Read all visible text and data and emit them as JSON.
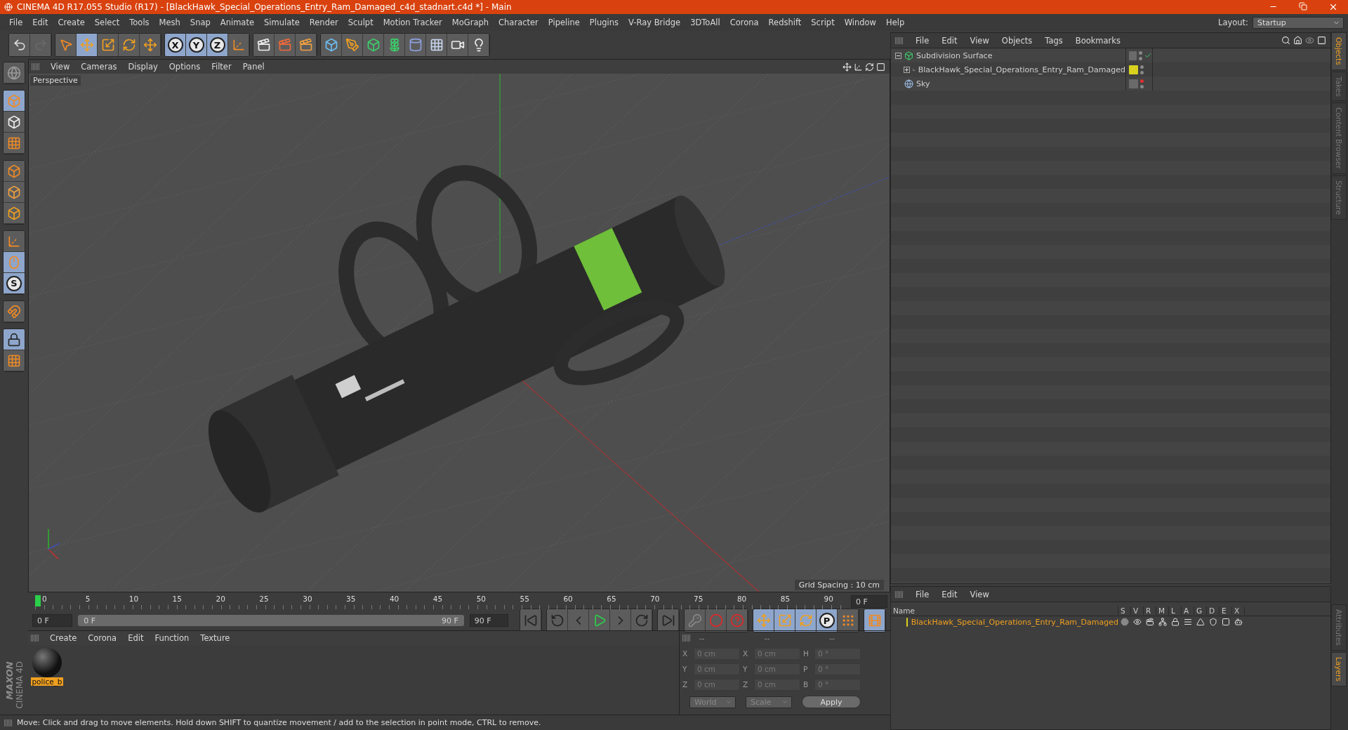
{
  "window": {
    "title": "CINEMA 4D R17.055 Studio (R17) - [BlackHawk_Special_Operations_Entry_Ram_Damaged_c4d_stadnart.c4d *] - Main"
  },
  "menu": [
    "File",
    "Edit",
    "Create",
    "Select",
    "Tools",
    "Mesh",
    "Snap",
    "Animate",
    "Simulate",
    "Render",
    "Sculpt",
    "Motion Tracker",
    "MoGraph",
    "Character",
    "Pipeline",
    "Plugins",
    "V-Ray Bridge",
    "3DToAll",
    "Corona",
    "Redshift",
    "Script",
    "Window",
    "Help"
  ],
  "layout": {
    "label": "Layout:",
    "value": "Startup"
  },
  "toolbar": [
    {
      "tools": [
        {
          "kind": "undo",
          "selected": false
        },
        {
          "kind": "redo",
          "selected": false
        }
      ]
    },
    {
      "tools": [
        {
          "kind": "select",
          "selected": false
        },
        {
          "kind": "move",
          "selected": true
        },
        {
          "kind": "scale",
          "selected": false
        },
        {
          "kind": "rotate",
          "selected": false
        },
        {
          "kind": "transform",
          "selected": false
        }
      ]
    },
    {
      "tools": [
        {
          "kind": "axis_lock",
          "label": "X",
          "selected": true
        },
        {
          "kind": "axis_lock",
          "label": "Y",
          "selected": true
        },
        {
          "kind": "axis_lock",
          "label": "Z",
          "selected": true
        },
        {
          "kind": "coords",
          "selected": false
        }
      ]
    },
    {
      "tools": [
        {
          "kind": "render_view",
          "selected": false
        },
        {
          "kind": "render",
          "selected": false
        },
        {
          "kind": "render_settings",
          "selected": false
        }
      ]
    },
    {
      "tools": [
        {
          "kind": "cube",
          "selected": false
        },
        {
          "kind": "pen",
          "selected": false
        },
        {
          "kind": "subdivision",
          "selected": false
        },
        {
          "kind": "cloner",
          "selected": false
        },
        {
          "kind": "bend",
          "selected": false
        },
        {
          "kind": "floor",
          "selected": false
        },
        {
          "kind": "camera",
          "selected": false
        },
        {
          "kind": "light",
          "selected": false
        }
      ]
    }
  ],
  "left_toolbar": [
    {
      "tools": [
        {
          "kind": "editable",
          "selected": false
        }
      ]
    },
    {
      "tools": [
        {
          "kind": "model",
          "selected": true
        },
        {
          "kind": "texture",
          "selected": false
        },
        {
          "kind": "workplane",
          "selected": false
        }
      ]
    },
    {
      "tools": [
        {
          "kind": "points",
          "selected": false
        },
        {
          "kind": "edges",
          "selected": false
        },
        {
          "kind": "polygons",
          "selected": false
        }
      ]
    },
    {
      "tools": [
        {
          "kind": "axis",
          "selected": false
        },
        {
          "kind": "tweak",
          "selected": true
        },
        {
          "kind": "snap",
          "label": "S",
          "selected": true
        }
      ]
    },
    {
      "tools": [
        {
          "kind": "magnet",
          "selected": false
        }
      ]
    },
    {
      "tools": [
        {
          "kind": "lock_grid",
          "selected": true
        },
        {
          "kind": "align_grid",
          "selected": false
        }
      ]
    }
  ],
  "viewport": {
    "menu": [
      "View",
      "Cameras",
      "Display",
      "Options",
      "Filter",
      "Panel"
    ],
    "camera": "Perspective",
    "grid_spacing": "Grid Spacing : 10 cm"
  },
  "timeline": {
    "ticks": [
      "0",
      "5",
      "10",
      "15",
      "20",
      "25",
      "30",
      "35",
      "40",
      "45",
      "50",
      "55",
      "60",
      "65",
      "70",
      "75",
      "80",
      "85",
      "90"
    ],
    "current": "0 F",
    "level": 1,
    "start": "0 F",
    "range_start": "0 F",
    "range_end": "90 F",
    "end": "90 F"
  },
  "playback": [
    {
      "tools": [
        {
          "kind": "to_start",
          "selected": false
        }
      ]
    },
    {
      "tools": [
        {
          "kind": "prev_key",
          "selected": false
        },
        {
          "kind": "prev_frame",
          "selected": false
        },
        {
          "kind": "play",
          "selected": false
        },
        {
          "kind": "next_frame",
          "selected": false
        },
        {
          "kind": "next_key",
          "selected": false
        }
      ]
    },
    {
      "tools": [
        {
          "kind": "to_end",
          "selected": false
        }
      ]
    },
    {
      "tools": [
        {
          "kind": "key",
          "selected": false
        },
        {
          "kind": "record",
          "selected": false
        },
        {
          "kind": "autokey",
          "selected": false
        }
      ]
    },
    {
      "tools": [
        {
          "kind": "move",
          "selected": true
        },
        {
          "kind": "scale",
          "selected": true
        },
        {
          "kind": "rotate",
          "selected": true
        },
        {
          "kind": "param",
          "label": "P",
          "selected": true
        },
        {
          "kind": "points_grid",
          "selected": false
        }
      ]
    },
    {
      "tools": [
        {
          "kind": "film",
          "selected": true
        }
      ]
    }
  ],
  "materials": {
    "menu": [
      "Create",
      "Corona",
      "Edit",
      "Function",
      "Texture"
    ],
    "items": [
      {
        "name": "police_b",
        "selected": true
      }
    ]
  },
  "coordinates": {
    "headers": [
      "--",
      "--",
      "--"
    ],
    "rows": [
      {
        "axis": "X",
        "value": "0 cm",
        "axis2": "X",
        "value2": "0 cm",
        "axis3": "H",
        "value3": "0 °"
      },
      {
        "axis": "Y",
        "value": "0 cm",
        "axis2": "Y",
        "value2": "0 cm",
        "axis3": "P",
        "value3": "0 °"
      },
      {
        "axis": "Z",
        "value": "0 cm",
        "axis2": "Z",
        "value2": "0 cm",
        "axis3": "B",
        "value3": "0 °"
      }
    ],
    "mode": "World",
    "mode2": "Scale",
    "apply": "Apply",
    "disabled": true
  },
  "logo": {
    "brand": "MAXON",
    "product": "CINEMA 4D"
  },
  "status_bar": "Move: Click and drag to move elements. Hold down SHIFT to quantize movement / add to the selection in point mode, CTRL to remove.",
  "objects": {
    "menu": [
      "File",
      "Edit",
      "View",
      "Objects",
      "Tags",
      "Bookmarks"
    ],
    "tree": [
      {
        "name": "Subdivision Surface",
        "kind": "subdivision",
        "expandable": true,
        "expanded": true,
        "checked": true,
        "hidden": false,
        "children": [
          {
            "name": "BlackHawk_Special_Operations_Entry_Ram_Damaged",
            "kind": "null",
            "expandable": true,
            "expanded": false,
            "checked": false,
            "hidden": false,
            "color": "#d8d21e"
          }
        ]
      },
      {
        "name": "Sky",
        "kind": "sky",
        "expandable": false,
        "checked": false,
        "hidden": true
      }
    ]
  },
  "layers": {
    "menu": [
      "File",
      "Edit",
      "View"
    ],
    "columns": [
      "Name",
      "S",
      "V",
      "R",
      "M",
      "L",
      "A",
      "G",
      "D",
      "E",
      "X"
    ],
    "rows": [
      {
        "name": "BlackHawk_Special_Operations_Entry_Ram_Damaged",
        "color": "#d8d21e"
      }
    ]
  },
  "side_tabs": [
    {
      "label": "Objects",
      "selected": true
    },
    {
      "label": "Takes",
      "selected": false
    },
    {
      "label": "Content Browser",
      "selected": false
    },
    {
      "label": "Structure",
      "selected": false
    }
  ],
  "side_tabs_lower": [
    {
      "label": "Attributes",
      "selected": false
    },
    {
      "label": "Layers",
      "selected": true
    }
  ]
}
